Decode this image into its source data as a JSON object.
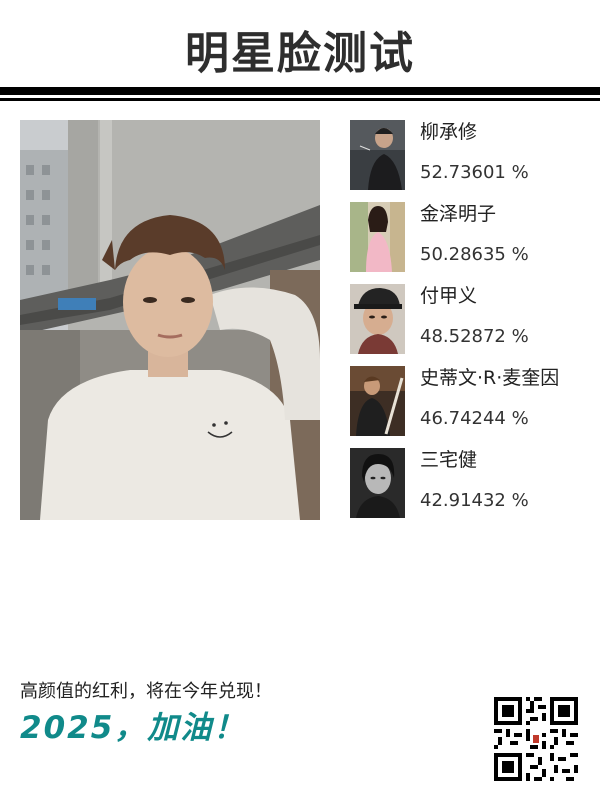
{
  "header": {
    "title": "明星脸测试"
  },
  "results": [
    {
      "name": "柳承修",
      "score": "52.73601 %",
      "thumb_icon": "celebrity-portrait-smoking"
    },
    {
      "name": "金泽明子",
      "score": "50.28635 %",
      "thumb_icon": "celebrity-portrait-pink-dress"
    },
    {
      "name": "付甲义",
      "score": "48.52872 %",
      "thumb_icon": "celebrity-portrait-cap"
    },
    {
      "name": "史蒂文·R·麦奎因",
      "score": "46.74244 %",
      "thumb_icon": "celebrity-portrait-action"
    },
    {
      "name": "三宅健",
      "score": "42.91432 %",
      "thumb_icon": "celebrity-portrait-bw"
    }
  ],
  "footer": {
    "caption": "高颜值的红利，将在今年兑现！",
    "slogan": "2025，加油！"
  },
  "colors": {
    "accent": "#108a8a",
    "title": "#2e2e2e",
    "rule": "#000000"
  }
}
